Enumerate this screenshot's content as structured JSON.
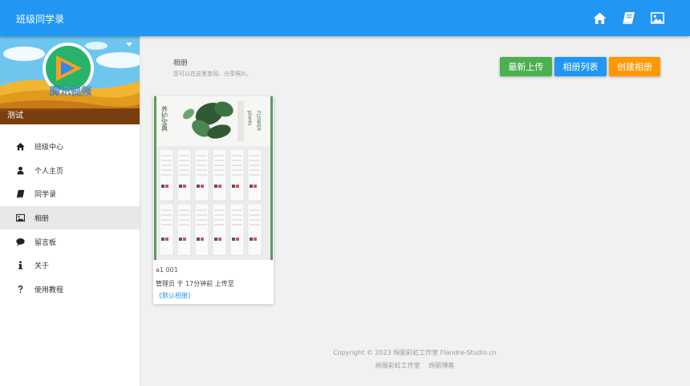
{
  "app": {
    "title": "班级同学录"
  },
  "topbar": {
    "icons": [
      "home-icon",
      "book-icon",
      "image-icon"
    ]
  },
  "sidebar": {
    "class_name": "测试",
    "cover_logo_text": "腾讯视频",
    "items": [
      {
        "label": "班级中心",
        "icon": "home-icon"
      },
      {
        "label": "个人主页",
        "icon": "user-icon"
      },
      {
        "label": "同学录",
        "icon": "book-icon"
      },
      {
        "label": "相册",
        "icon": "image-icon",
        "active": true
      },
      {
        "label": "留言板",
        "icon": "comment-icon"
      },
      {
        "label": "关于",
        "icon": "info-icon"
      },
      {
        "label": "使用教程",
        "icon": "question-icon"
      }
    ]
  },
  "main": {
    "title": "相册",
    "subtitle": "您可以在这里查阅、分享照片。",
    "buttons": {
      "latest": "最新上传",
      "list": "相册列表",
      "create": "创建相册"
    }
  },
  "photo": {
    "title": "a1 001",
    "meta": "管理员 于 17分钟前 上传至",
    "album": "《默认相册》",
    "image_text_1": "养护宝典",
    "image_text_2": "FLOWER",
    "image_text_3": "plants"
  },
  "footer": {
    "copyright": "Copyright © 2023 绚丽彩虹工作室 Flandre-Studio.cn",
    "links": [
      "绚丽彩虹工作室",
      "绚丽博客"
    ]
  },
  "colors": {
    "primary": "#2196f3",
    "green": "#4caf50",
    "orange": "#ff9800"
  }
}
